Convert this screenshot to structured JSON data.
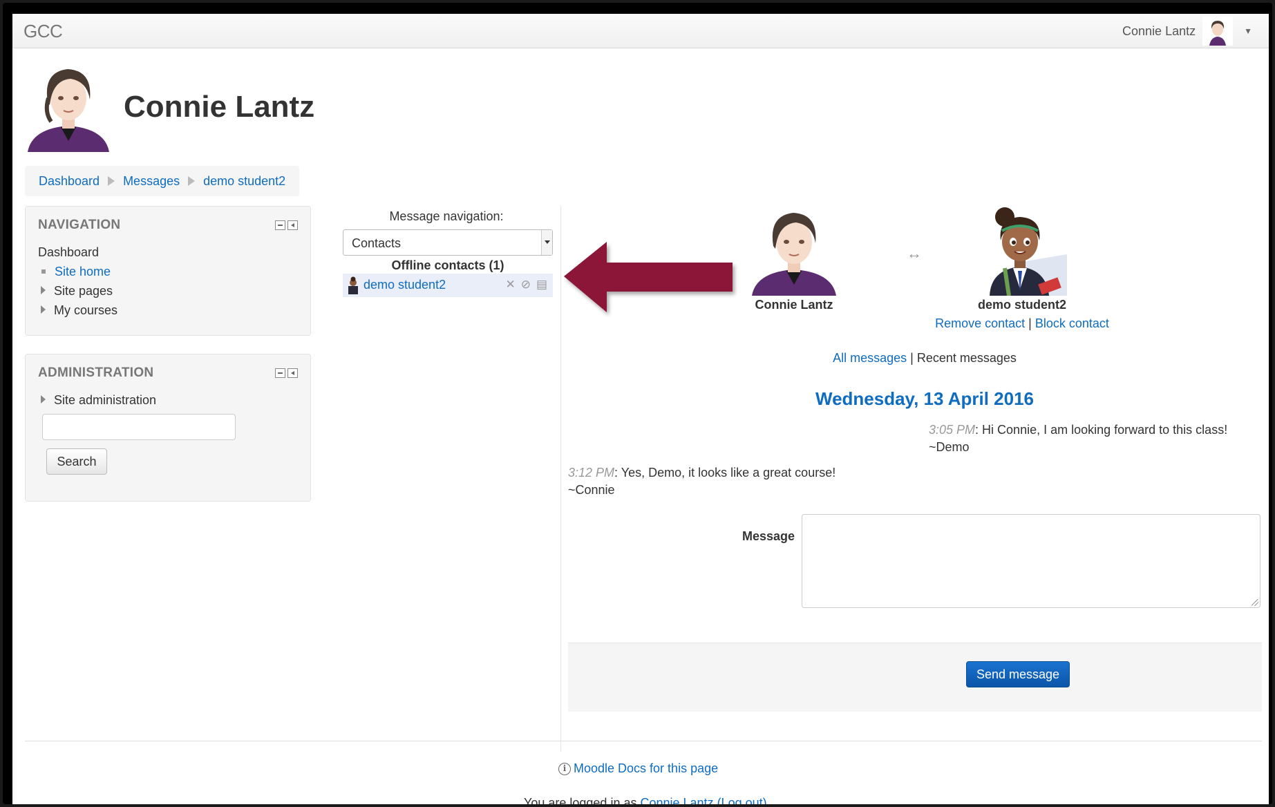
{
  "navbar": {
    "brand": "GCC",
    "user_name": "Connie Lantz"
  },
  "header": {
    "title": "Connie Lantz"
  },
  "breadcrumb": {
    "items": [
      "Dashboard",
      "Messages",
      "demo student2"
    ]
  },
  "navigation_block": {
    "title": "NAVIGATION",
    "dashboard": "Dashboard",
    "items": [
      "Site home",
      "Site pages",
      "My courses"
    ]
  },
  "administration_block": {
    "title": "ADMINISTRATION",
    "site_admin": "Site administration",
    "search_placeholder": "",
    "search_label": "Search"
  },
  "message_navigation": {
    "label": "Message navigation:",
    "selected": "Contacts",
    "contacts_heading": "Offline contacts (1)",
    "contact_name": "demo student2"
  },
  "conversation": {
    "me_name": "Connie Lantz",
    "them_name": "demo student2",
    "remove_contact": "Remove contact",
    "separator": "|",
    "block_contact": "Block contact",
    "all_messages": "All messages",
    "recent_messages": "Recent messages",
    "day": "Wednesday, 13 April 2016",
    "messages": [
      {
        "time": "3:05 PM",
        "text": ": Hi Connie, I am looking forward to this class!",
        "signature": "~Demo"
      },
      {
        "time": "3:12 PM",
        "text": ": Yes, Demo, it looks like a great course!",
        "signature": "~Connie"
      }
    ]
  },
  "compose": {
    "label": "Message",
    "value": "",
    "send_label": "Send message"
  },
  "footer": {
    "docs_link": "Moodle Docs for this page",
    "logged_in_prefix": "You are logged in as ",
    "logged_in_user": "Connie Lantz",
    "logout": "(Log out)"
  },
  "colors": {
    "link": "#0f6cbf",
    "annotation_arrow": "#8b1538",
    "send_button": "#0b55a8"
  }
}
